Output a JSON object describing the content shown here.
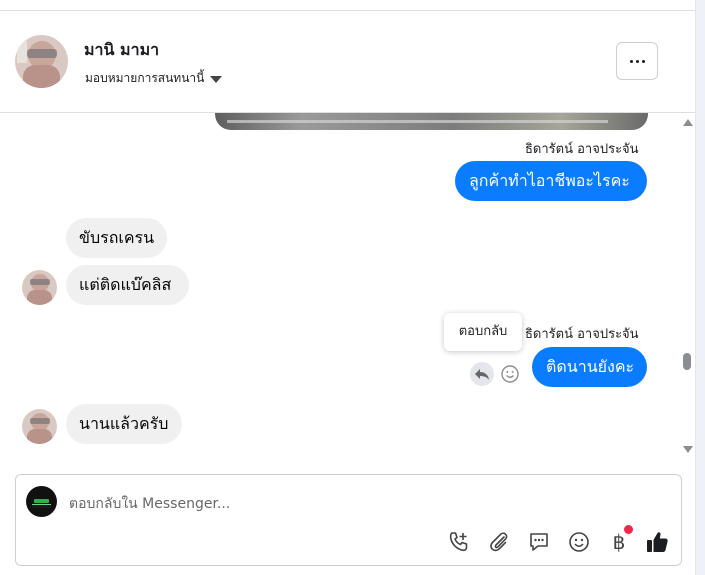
{
  "header": {
    "contact_name": "มานิ มามา",
    "assign_label": "มอบหมายการสนทนานี้"
  },
  "messages": [
    {
      "sender": "ธิดารัตน์ อาจประจัน",
      "text": "ลูกค้าทำไอาชีพอะไรคะ",
      "direction": "outgoing"
    },
    {
      "text": "ขับรถเครน",
      "direction": "incoming"
    },
    {
      "text": "แต่ติดแบ๊คลิส",
      "direction": "incoming"
    },
    {
      "sender": "ธิดารัตน์ อาจประจัน",
      "text": "ติดนานยังคะ",
      "direction": "outgoing"
    },
    {
      "text": "นานแล้วครับ",
      "direction": "incoming"
    }
  ],
  "hover_actions": {
    "tooltip": "ตอบกลับ",
    "reply_icon": "reply-arrow-icon",
    "react_icon": "smile-icon"
  },
  "composer": {
    "placeholder": "ตอบกลับใน Messenger...",
    "tools": [
      "phone-plus-icon",
      "paperclip-icon",
      "saved-reply-icon",
      "emoji-icon",
      "baht-payment-icon",
      "thumbs-up-icon"
    ],
    "baht_symbol": "฿"
  },
  "colors": {
    "outgoing_bubble": "#0a7cff",
    "incoming_bubble": "#f0f0f0",
    "notification_dot": "#f02849"
  }
}
